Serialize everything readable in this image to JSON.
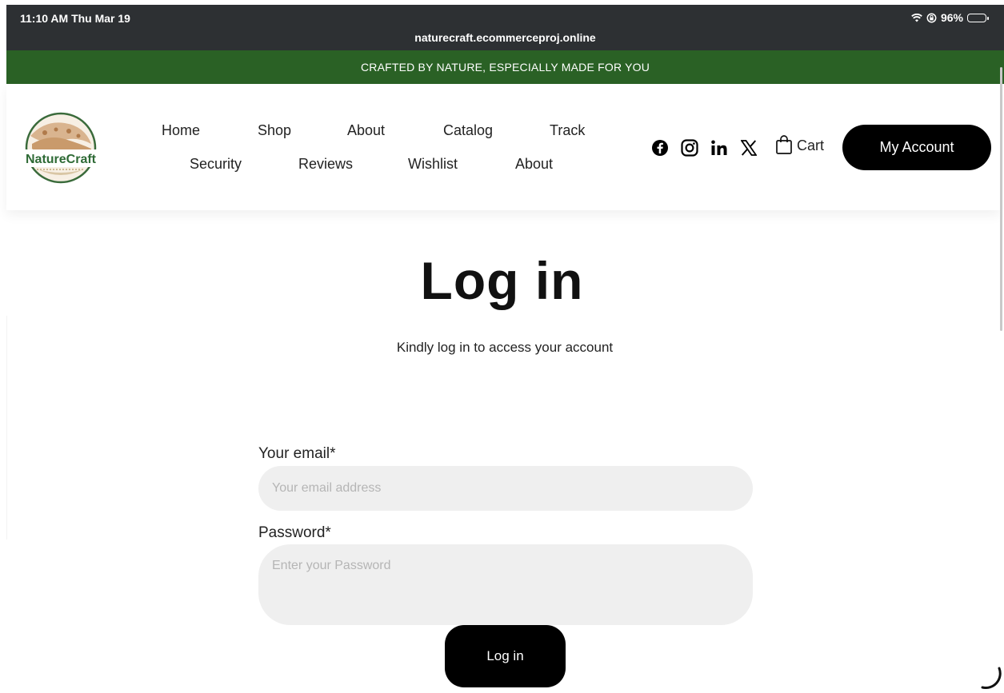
{
  "statusbar": {
    "time": "11:10 AM  Thu Mar 19",
    "url": "naturecraft.ecommerceproj.online",
    "battery": "96%"
  },
  "promo": {
    "text": "CRAFTED BY NATURE, ESPECIALLY MADE FOR YOU"
  },
  "header": {
    "logo_text": "NatureCraft",
    "nav_row1": [
      "Home",
      "Shop",
      "About",
      "Catalog",
      "Track"
    ],
    "nav_row2": [
      "Security",
      "Reviews",
      "Wishlist",
      "About"
    ],
    "social_icons": [
      "facebook-icon",
      "instagram-icon",
      "linkedin-icon",
      "x-icon"
    ],
    "cart_label": "Cart",
    "account_label": "My Account"
  },
  "main": {
    "title": "Log in",
    "subtitle": "Kindly log in to access your account",
    "email_label": "Your email*",
    "email_placeholder": "Your email address",
    "password_label": "Password*",
    "password_placeholder": "Enter your Password",
    "submit_label": "Log in"
  },
  "colors": {
    "promo_bg": "#2a6125",
    "statusbar_bg": "#2d3033",
    "button_bg": "#000000",
    "field_bg": "#efefef"
  }
}
